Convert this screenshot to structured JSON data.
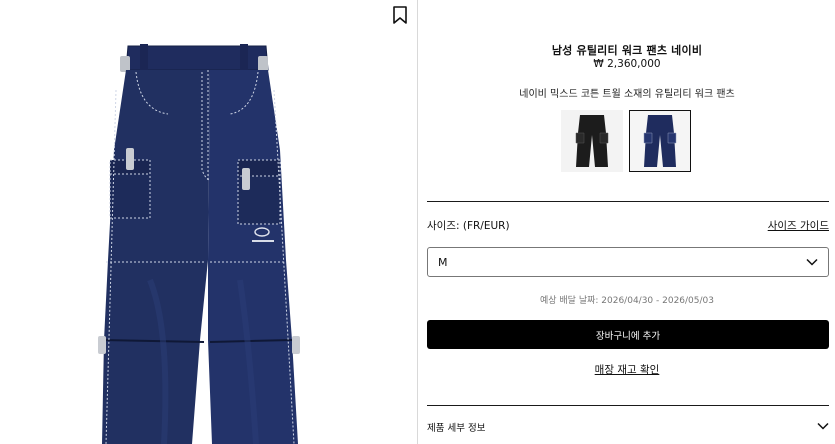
{
  "product": {
    "title": "남성 유틸리티 워크 팬츠 네이비",
    "price": "₩ 2,360,000",
    "description": "네이비 믹스드 코튼 트윌 소재의 유틸리티 워크 팬츠"
  },
  "colors": {
    "navy": "#1f2c5e",
    "black": "#1c1c1c",
    "stitch": "#cfd6e6",
    "button": "#000000"
  },
  "icons": {
    "bookmark": "bookmark-icon",
    "select_chevron": "chevron-down-icon",
    "details_chevron": "chevron-down-icon"
  },
  "variants": [
    {
      "name": "black",
      "selected": false
    },
    {
      "name": "navy",
      "selected": true
    }
  ],
  "size": {
    "label": "사이즈: (FR/EUR)",
    "guide_link": "사이즈 가이드",
    "selected": "M"
  },
  "delivery": "예상 배달 날짜: 2026/04/30 - 2026/05/03",
  "cart_button": "장바구니에 추가",
  "stock_link": "매장 재고 확인",
  "details_label": "제품 세부 정보"
}
